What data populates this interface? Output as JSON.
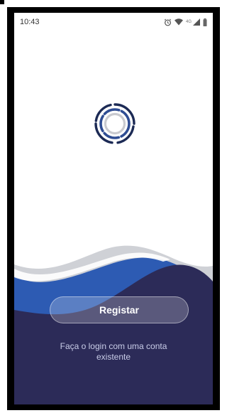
{
  "status_bar": {
    "time": "10:43",
    "network": "4G",
    "icons": [
      "alarm-icon",
      "wifi-icon",
      "signal-icon",
      "battery-icon"
    ]
  },
  "logo": {
    "icon": "c-circle-logo-icon"
  },
  "actions": {
    "register_label": "Registar",
    "login_text": "Faça o login com uma conta existente"
  },
  "colors": {
    "navy": "#2c2b58",
    "blue_wave": "#2d5bb3",
    "gray_wave": "#cfd1d6",
    "logo_ring": "#1c2a55"
  }
}
